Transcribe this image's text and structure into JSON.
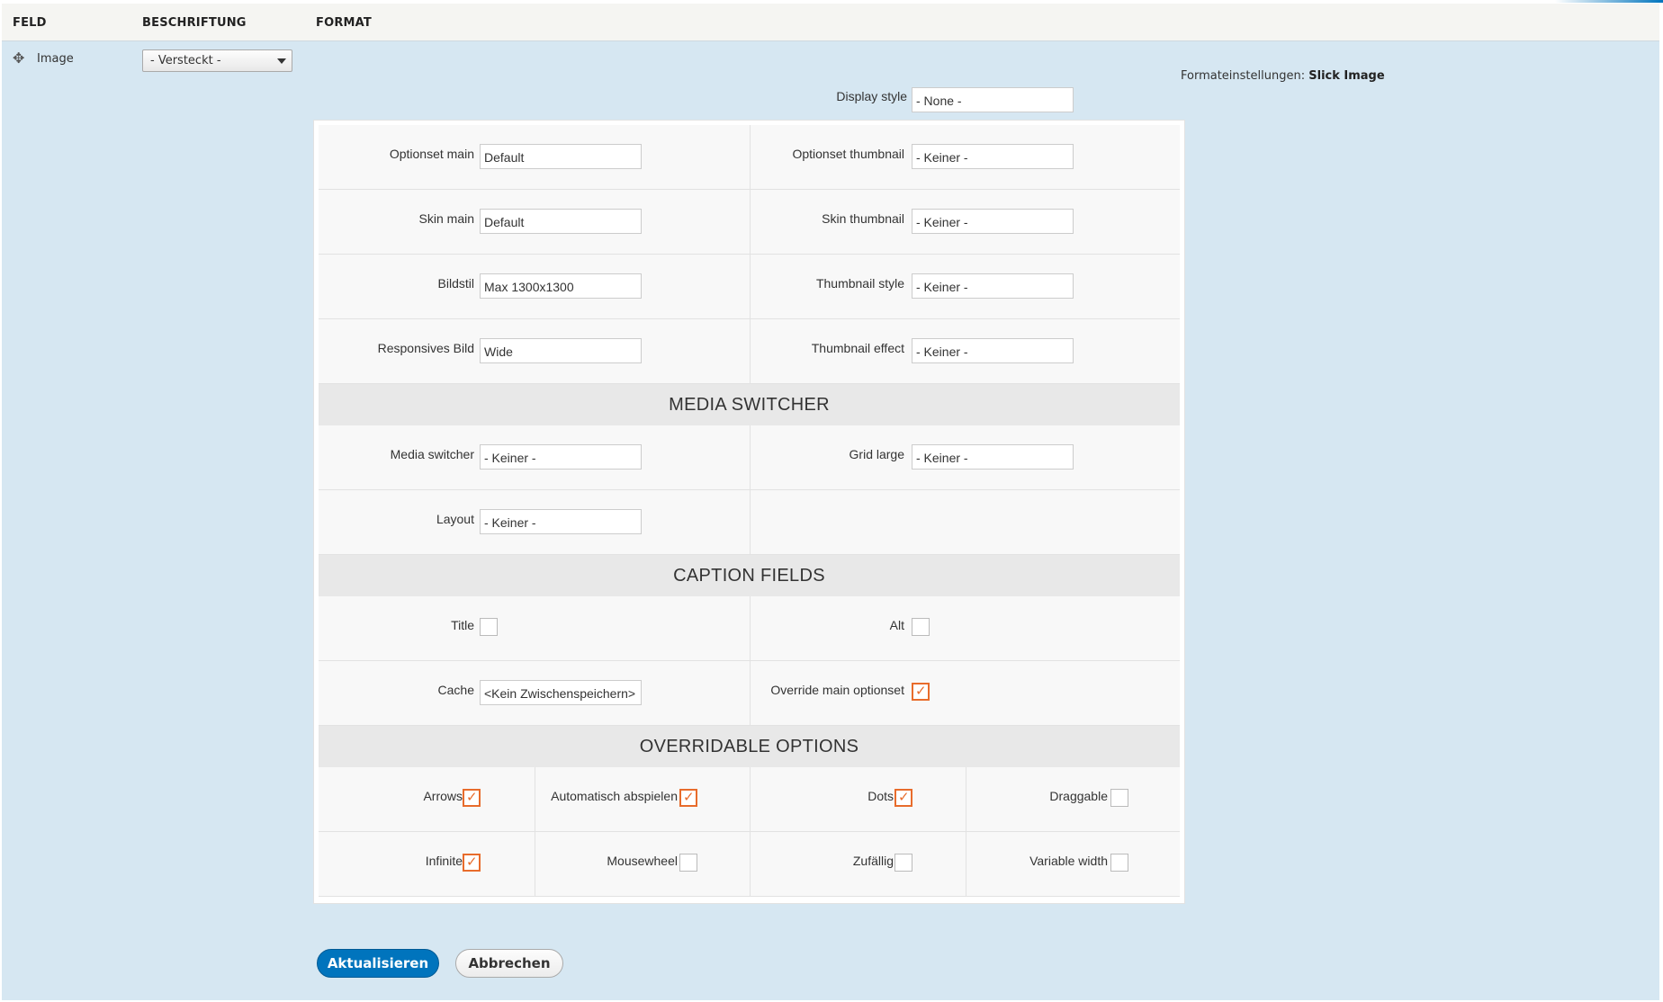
{
  "header": {
    "col_field": "FELD",
    "col_label": "BESCHRIFTUNG",
    "col_format": "FORMAT"
  },
  "row": {
    "field_name": "Image",
    "label_select": "- Versteckt -",
    "format_summary_prefix": "Formateinstellungen:",
    "format_summary_value": "Slick Image"
  },
  "display_style": {
    "label": "Display style",
    "value": "- None -"
  },
  "settings": {
    "optionset_main": {
      "label": "Optionset main",
      "value": "Default"
    },
    "optionset_thumbnail": {
      "label": "Optionset thumbnail",
      "value": "- Keiner -"
    },
    "skin_main": {
      "label": "Skin main",
      "value": "Default"
    },
    "skin_thumbnail": {
      "label": "Skin thumbnail",
      "value": "- Keiner -"
    },
    "bildstil": {
      "label": "Bildstil",
      "value": "Max 1300x1300"
    },
    "thumbnail_style": {
      "label": "Thumbnail style",
      "value": "- Keiner -"
    },
    "responsive": {
      "label": "Responsives Bild",
      "value": "Wide"
    },
    "thumbnail_effect": {
      "label": "Thumbnail effect",
      "value": "- Keiner -"
    }
  },
  "media_switcher": {
    "heading": "MEDIA SWITCHER",
    "switcher": {
      "label": "Media switcher",
      "value": "- Keiner -"
    },
    "grid_large": {
      "label": "Grid large",
      "value": "- Keiner -"
    },
    "layout": {
      "label": "Layout",
      "value": "- Keiner -"
    }
  },
  "caption_fields": {
    "heading": "CAPTION FIELDS",
    "title": {
      "label": "Title",
      "checked": false
    },
    "alt": {
      "label": "Alt",
      "checked": false
    },
    "cache": {
      "label": "Cache",
      "value": "<Kein Zwischenspeichern>"
    },
    "override": {
      "label": "Override main optionset",
      "checked": true
    }
  },
  "overridable": {
    "heading": "OVERRIDABLE OPTIONS",
    "items": [
      {
        "label": "Arrows",
        "checked": true
      },
      {
        "label": "Automatisch abspielen",
        "checked": true
      },
      {
        "label": "Dots",
        "checked": true
      },
      {
        "label": "Draggable",
        "checked": false
      },
      {
        "label": "Infinite",
        "checked": true
      },
      {
        "label": "Mousewheel",
        "checked": false
      },
      {
        "label": "Zufällig",
        "checked": false
      },
      {
        "label": "Variable width",
        "checked": false
      }
    ]
  },
  "actions": {
    "update": "Aktualisieren",
    "cancel": "Abbrechen"
  },
  "colors": {
    "accent": "#0074bd",
    "checkbox_on": "#e86c2c",
    "panel_bg": "#d6e7f2"
  }
}
